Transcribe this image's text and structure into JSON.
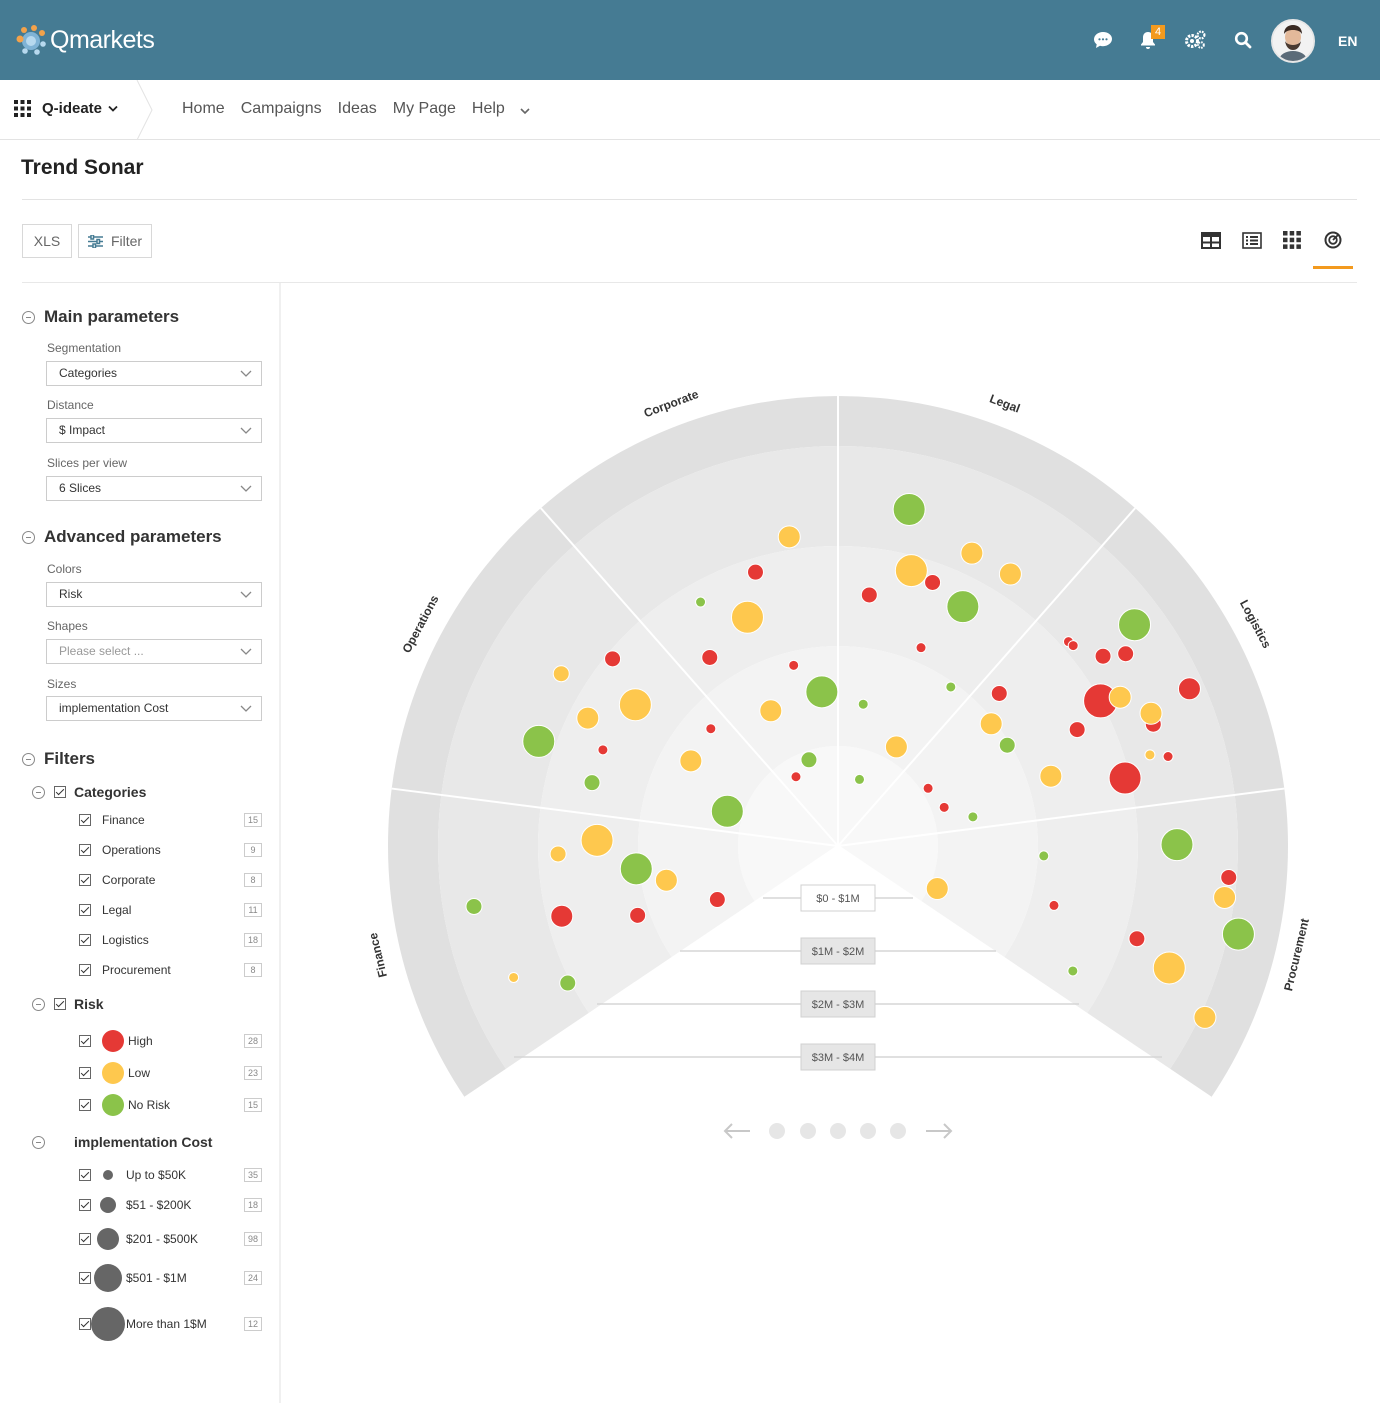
{
  "app": {
    "logo_text": "Qmarkets",
    "notifications_count": "4",
    "language": "EN"
  },
  "nav": {
    "app_name": "Q-ideate",
    "links": [
      "Home",
      "Campaigns",
      "Ideas",
      "My Page",
      "Help"
    ]
  },
  "page": {
    "title": "Trend Sonar"
  },
  "toolbar": {
    "xls_label": "XLS",
    "filter_label": "Filter"
  },
  "sidebar": {
    "main_parameters": {
      "title": "Main parameters",
      "segmentation": {
        "label": "Segmentation",
        "value": "Categories"
      },
      "distance": {
        "label": "Distance",
        "value": "$ Impact"
      },
      "slices": {
        "label": "Slices per view",
        "value": "6 Slices"
      }
    },
    "advanced_parameters": {
      "title": "Advanced parameters",
      "colors": {
        "label": "Colors",
        "value": "Risk"
      },
      "shapes": {
        "label": "Shapes",
        "placeholder": "Please select ..."
      },
      "sizes": {
        "label": "Sizes",
        "value": "implementation Cost"
      }
    },
    "filters": {
      "title": "Filters",
      "categories": {
        "title": "Categories",
        "items": [
          {
            "label": "Finance",
            "count": "15"
          },
          {
            "label": "Operations",
            "count": "9"
          },
          {
            "label": "Corporate",
            "count": "8"
          },
          {
            "label": "Legal",
            "count": "11"
          },
          {
            "label": "Logistics",
            "count": "18"
          },
          {
            "label": "Procurement",
            "count": "8"
          }
        ]
      },
      "risk": {
        "title": "Risk",
        "items": [
          {
            "label": "High",
            "count": "28",
            "color": "#e53935"
          },
          {
            "label": "Low",
            "count": "23",
            "color": "#fec84e"
          },
          {
            "label": "No Risk",
            "count": "15",
            "color": "#8bc34a"
          }
        ]
      },
      "cost": {
        "title": "implementation Cost",
        "items": [
          {
            "label": "Up to $50K",
            "count": "35"
          },
          {
            "label": "$51 - $200K",
            "count": "18"
          },
          {
            "label": "$201 - $500K",
            "count": "98"
          },
          {
            "label": "$501 - $1M",
            "count": "24"
          },
          {
            "label": "More than 1$M",
            "count": "12"
          }
        ]
      }
    }
  },
  "chart_data": {
    "type": "scatter",
    "segments": [
      "Finance",
      "Operations",
      "Corporate",
      "Legal",
      "Logistics",
      "Procurement"
    ],
    "rings": [
      "$0 - $1M",
      "$1M - $2M",
      "$2M - $3M",
      "$3M - $4M"
    ],
    "colors": {
      "High": "#e53935",
      "Low": "#fec84e",
      "No Risk": "#8bc34a"
    },
    "points": [
      {
        "seg": "Finance",
        "dist": 3.59,
        "risk": "No Risk",
        "size": 2
      },
      {
        "seg": "Finance",
        "dist": 3.4,
        "risk": "Low",
        "size": 1
      },
      {
        "seg": "Finance",
        "dist": 2.7,
        "risk": "Low",
        "size": 2
      },
      {
        "seg": "Finance",
        "dist": 2.75,
        "risk": "High",
        "size": 3
      },
      {
        "seg": "Finance",
        "dist": 2.93,
        "risk": "No Risk",
        "size": 2
      },
      {
        "seg": "Finance",
        "dist": 1.93,
        "risk": "No Risk",
        "size": 4
      },
      {
        "seg": "Finance",
        "dist": 2.02,
        "risk": "High",
        "size": 2
      },
      {
        "seg": "Finance",
        "dist": 2.31,
        "risk": "Low",
        "size": 4
      },
      {
        "seg": "Finance",
        "dist": 1.65,
        "risk": "Low",
        "size": 3
      },
      {
        "seg": "Finance",
        "dist": 1.22,
        "risk": "High",
        "size": 2
      },
      {
        "seg": "Operations",
        "dist": 3.16,
        "risk": "Low",
        "size": 2
      },
      {
        "seg": "Operations",
        "dist": 3.07,
        "risk": "No Risk",
        "size": 4
      },
      {
        "seg": "Operations",
        "dist": 2.83,
        "risk": "High",
        "size": 2
      },
      {
        "seg": "Operations",
        "dist": 2.71,
        "risk": "Low",
        "size": 3
      },
      {
        "seg": "Operations",
        "dist": 2.44,
        "risk": "No Risk",
        "size": 2
      },
      {
        "seg": "Operations",
        "dist": 2.37,
        "risk": "Low",
        "size": 4
      },
      {
        "seg": "Operations",
        "dist": 2.44,
        "risk": "High",
        "size": 1
      },
      {
        "seg": "Operations",
        "dist": 1.63,
        "risk": "High",
        "size": 1
      },
      {
        "seg": "Operations",
        "dist": 1.6,
        "risk": "Low",
        "size": 3
      },
      {
        "seg": "Operations",
        "dist": 1.06,
        "risk": "No Risk",
        "size": 4
      },
      {
        "seg": "Corporate",
        "dist": 2.76,
        "risk": "High",
        "size": 2
      },
      {
        "seg": "Corporate",
        "dist": 2.7,
        "risk": "No Risk",
        "size": 1
      },
      {
        "seg": "Corporate",
        "dist": 3.03,
        "risk": "Low",
        "size": 3
      },
      {
        "seg": "Corporate",
        "dist": 2.36,
        "risk": "Low",
        "size": 4
      },
      {
        "seg": "Corporate",
        "dist": 2.18,
        "risk": "High",
        "size": 2
      },
      {
        "seg": "Corporate",
        "dist": 1.76,
        "risk": "High",
        "size": 1
      },
      {
        "seg": "Corporate",
        "dist": 1.41,
        "risk": "Low",
        "size": 3
      },
      {
        "seg": "Corporate",
        "dist": 1.45,
        "risk": "No Risk",
        "size": 4
      },
      {
        "seg": "Corporate",
        "dist": 0.81,
        "risk": "No Risk",
        "size": 2
      },
      {
        "seg": "Corporate",
        "dist": 0.71,
        "risk": "High",
        "size": 1
      },
      {
        "seg": "Legal",
        "dist": 3.12,
        "risk": "Low",
        "size": 3
      },
      {
        "seg": "Legal",
        "dist": 3.34,
        "risk": "No Risk",
        "size": 4
      },
      {
        "seg": "Legal",
        "dist": 3.12,
        "risk": "Low",
        "size": 3
      },
      {
        "seg": "Legal",
        "dist": 2.7,
        "risk": "High",
        "size": 2
      },
      {
        "seg": "Legal",
        "dist": 2.43,
        "risk": "High",
        "size": 2
      },
      {
        "seg": "Legal",
        "dist": 2.6,
        "risk": "No Risk",
        "size": 4
      },
      {
        "seg": "Legal",
        "dist": 2.75,
        "risk": "Low",
        "size": 4
      },
      {
        "seg": "Legal",
        "dist": 1.85,
        "risk": "No Risk",
        "size": 1
      },
      {
        "seg": "Legal",
        "dist": 2.05,
        "risk": "High",
        "size": 1
      },
      {
        "seg": "Legal",
        "dist": 1.34,
        "risk": "No Risk",
        "size": 1
      },
      {
        "seg": "Legal",
        "dist": 1.05,
        "risk": "Low",
        "size": 3
      },
      {
        "seg": "Legal",
        "dist": 0.6,
        "risk": "No Risk",
        "size": 1
      },
      {
        "seg": "Logistics",
        "dist": 3.75,
        "risk": "High",
        "size": 3
      },
      {
        "seg": "Logistics",
        "dist": 3.6,
        "risk": "No Risk",
        "size": 4
      },
      {
        "seg": "Logistics",
        "dist": 3.15,
        "risk": "Low",
        "size": 1
      },
      {
        "seg": "Logistics",
        "dist": 2.9,
        "risk": "High",
        "size": 5
      },
      {
        "seg": "Logistics",
        "dist": 2.98,
        "risk": "High",
        "size": 1
      },
      {
        "seg": "Logistics",
        "dist": 3.28,
        "risk": "High",
        "size": 2
      },
      {
        "seg": "Logistics",
        "dist": 3.36,
        "risk": "High",
        "size": 2
      },
      {
        "seg": "Logistics",
        "dist": 2.85,
        "risk": "High",
        "size": 4
      },
      {
        "seg": "Logistics",
        "dist": 2.56,
        "risk": "High",
        "size": 2
      },
      {
        "seg": "Logistics",
        "dist": 1.86,
        "risk": "Low",
        "size": 3
      },
      {
        "seg": "Logistics",
        "dist": 2.14,
        "risk": "Low",
        "size": 3
      },
      {
        "seg": "Logistics",
        "dist": 1.87,
        "risk": "No Risk",
        "size": 2
      },
      {
        "seg": "Logistics",
        "dist": 2.12,
        "risk": "High",
        "size": 2
      },
      {
        "seg": "Logistics",
        "dist": 3.3,
        "risk": "Low",
        "size": 3
      },
      {
        "seg": "Logistics",
        "dist": 3.16,
        "risk": "High",
        "size": 2
      },
      {
        "seg": "Logistics",
        "dist": 3.32,
        "risk": "High",
        "size": 1
      },
      {
        "seg": "Logistics",
        "dist": 3.09,
        "risk": "Low",
        "size": 3
      },
      {
        "seg": "Logistics",
        "dist": 2.99,
        "risk": "High",
        "size": 1
      },
      {
        "seg": "Logistics",
        "dist": 1.03,
        "risk": "High",
        "size": 1
      },
      {
        "seg": "Logistics",
        "dist": 0.97,
        "risk": "High",
        "size": 1
      },
      {
        "seg": "Logistics",
        "dist": 1.28,
        "risk": "No Risk",
        "size": 1
      },
      {
        "seg": "Procurement",
        "dist": 3.03,
        "risk": "High",
        "size": 2
      },
      {
        "seg": "Procurement",
        "dist": 3.82,
        "risk": "High",
        "size": 2
      },
      {
        "seg": "Procurement",
        "dist": 3.95,
        "risk": "Low",
        "size": 3
      },
      {
        "seg": "Procurement",
        "dist": 4.0,
        "risk": "No Risk",
        "size": 4
      },
      {
        "seg": "Procurement",
        "dist": 3.29,
        "risk": "No Risk",
        "size": 4
      },
      {
        "seg": "Procurement",
        "dist": 3.43,
        "risk": "Low",
        "size": 4
      },
      {
        "seg": "Procurement",
        "dist": 3.8,
        "risk": "Low",
        "size": 3
      },
      {
        "seg": "Procurement",
        "dist": 2.56,
        "risk": "No Risk",
        "size": 1
      },
      {
        "seg": "Procurement",
        "dist": 2.14,
        "risk": "High",
        "size": 1
      },
      {
        "seg": "Procurement",
        "dist": 1.96,
        "risk": "No Risk",
        "size": 1
      },
      {
        "seg": "Procurement",
        "dist": 0.98,
        "risk": "Low",
        "size": 3
      }
    ]
  },
  "pager": {
    "pages": 5
  }
}
